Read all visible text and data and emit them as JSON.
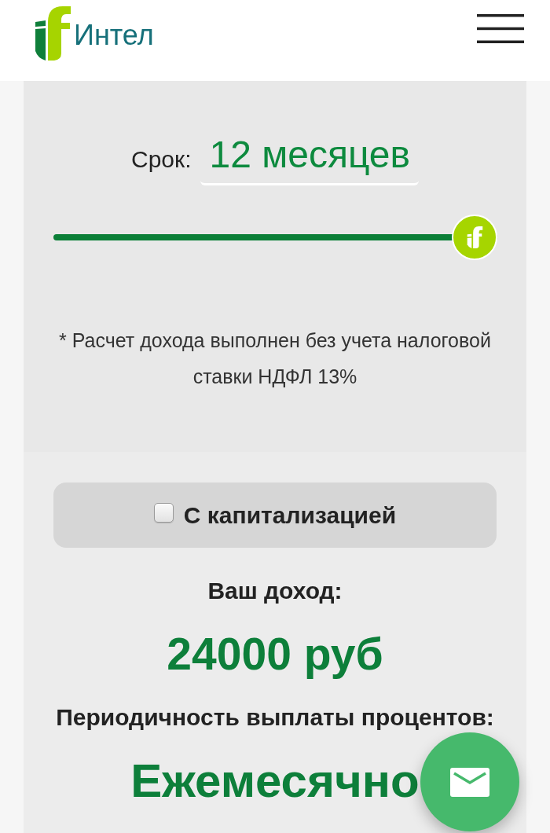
{
  "header": {
    "logo_text": "Интел"
  },
  "term": {
    "label": "Срок:",
    "value": "12 месяцев",
    "slider": {
      "level": 1
    }
  },
  "note": "* Расчет дохода выполнен без учета налоговой ставки НДФЛ 13%",
  "capitalization": {
    "label": "С капитализацией",
    "checked": false
  },
  "income": {
    "label": "Ваш доход:",
    "value": "24000 руб"
  },
  "payout": {
    "label": "Периодичность выплаты процентов:",
    "value": "Ежемесячно"
  }
}
